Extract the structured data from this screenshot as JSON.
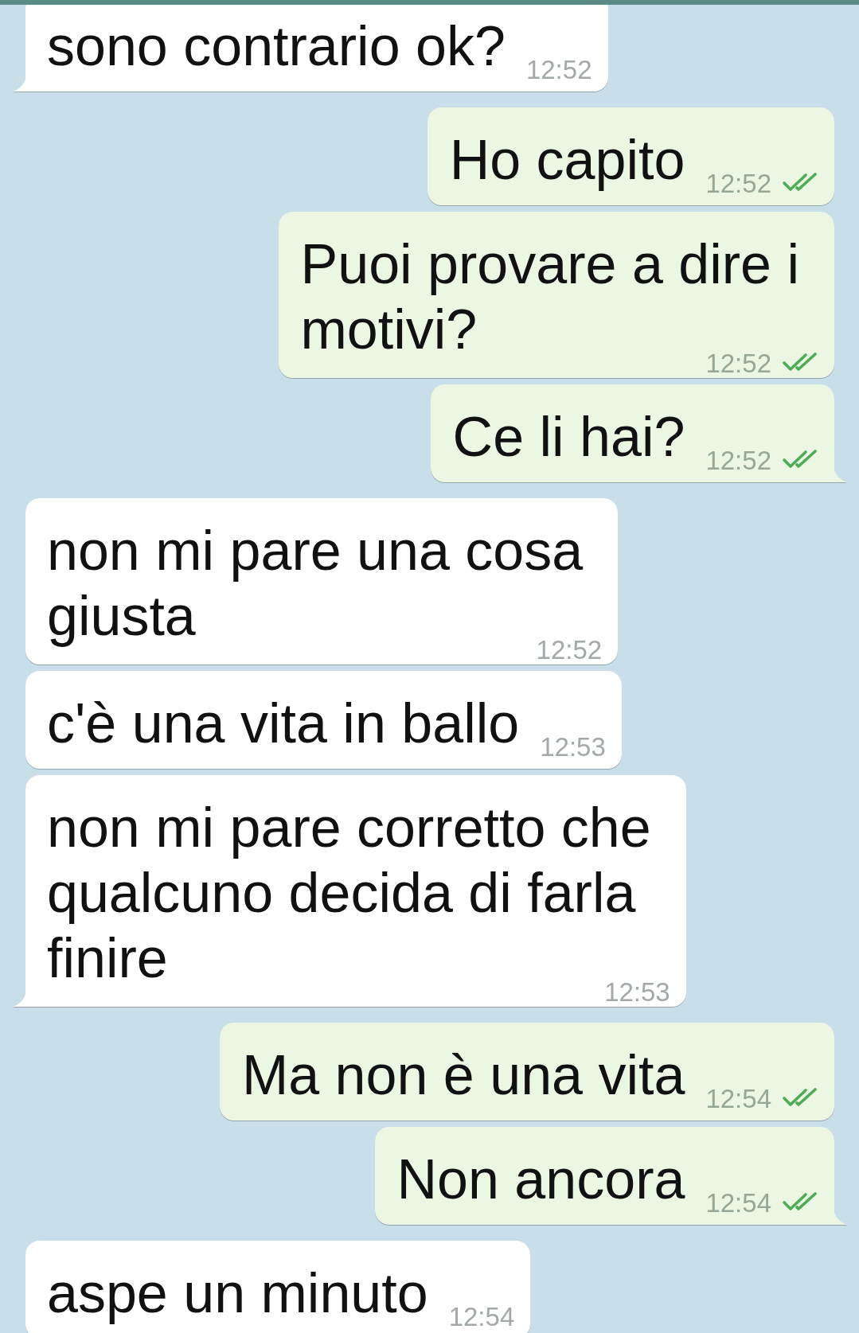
{
  "messages": [
    {
      "kind": "incoming",
      "lines": [
        "sono contrario ok?"
      ],
      "time": "12:52",
      "tail": true
    },
    {
      "kind": "outgoing",
      "lines": [
        "Ho capito"
      ],
      "time": "12:52",
      "read": true,
      "tail": false
    },
    {
      "kind": "outgoing",
      "lines": [
        "Puoi provare a dire i",
        "motivi?"
      ],
      "time": "12:52",
      "read": true,
      "tail": false
    },
    {
      "kind": "outgoing",
      "lines": [
        "Ce li hai?"
      ],
      "time": "12:52",
      "read": true,
      "tail": true
    },
    {
      "kind": "incoming",
      "lines": [
        "non mi pare una cosa",
        "giusta"
      ],
      "time": "12:52",
      "tail": false
    },
    {
      "kind": "incoming",
      "lines": [
        "c'è una vita in ballo"
      ],
      "time": "12:53",
      "tail": false
    },
    {
      "kind": "incoming",
      "lines": [
        "non mi pare corretto che",
        "qualcuno decida di farla",
        "finire"
      ],
      "time": "12:53",
      "tail": true
    },
    {
      "kind": "outgoing",
      "lines": [
        "Ma non è una vita"
      ],
      "time": "12:54",
      "read": true,
      "tail": false
    },
    {
      "kind": "outgoing",
      "lines": [
        "Non ancora"
      ],
      "time": "12:54",
      "read": true,
      "tail": true
    },
    {
      "kind": "incoming",
      "lines": [
        "aspe un minuto"
      ],
      "time": "12:54",
      "tail": false
    }
  ]
}
